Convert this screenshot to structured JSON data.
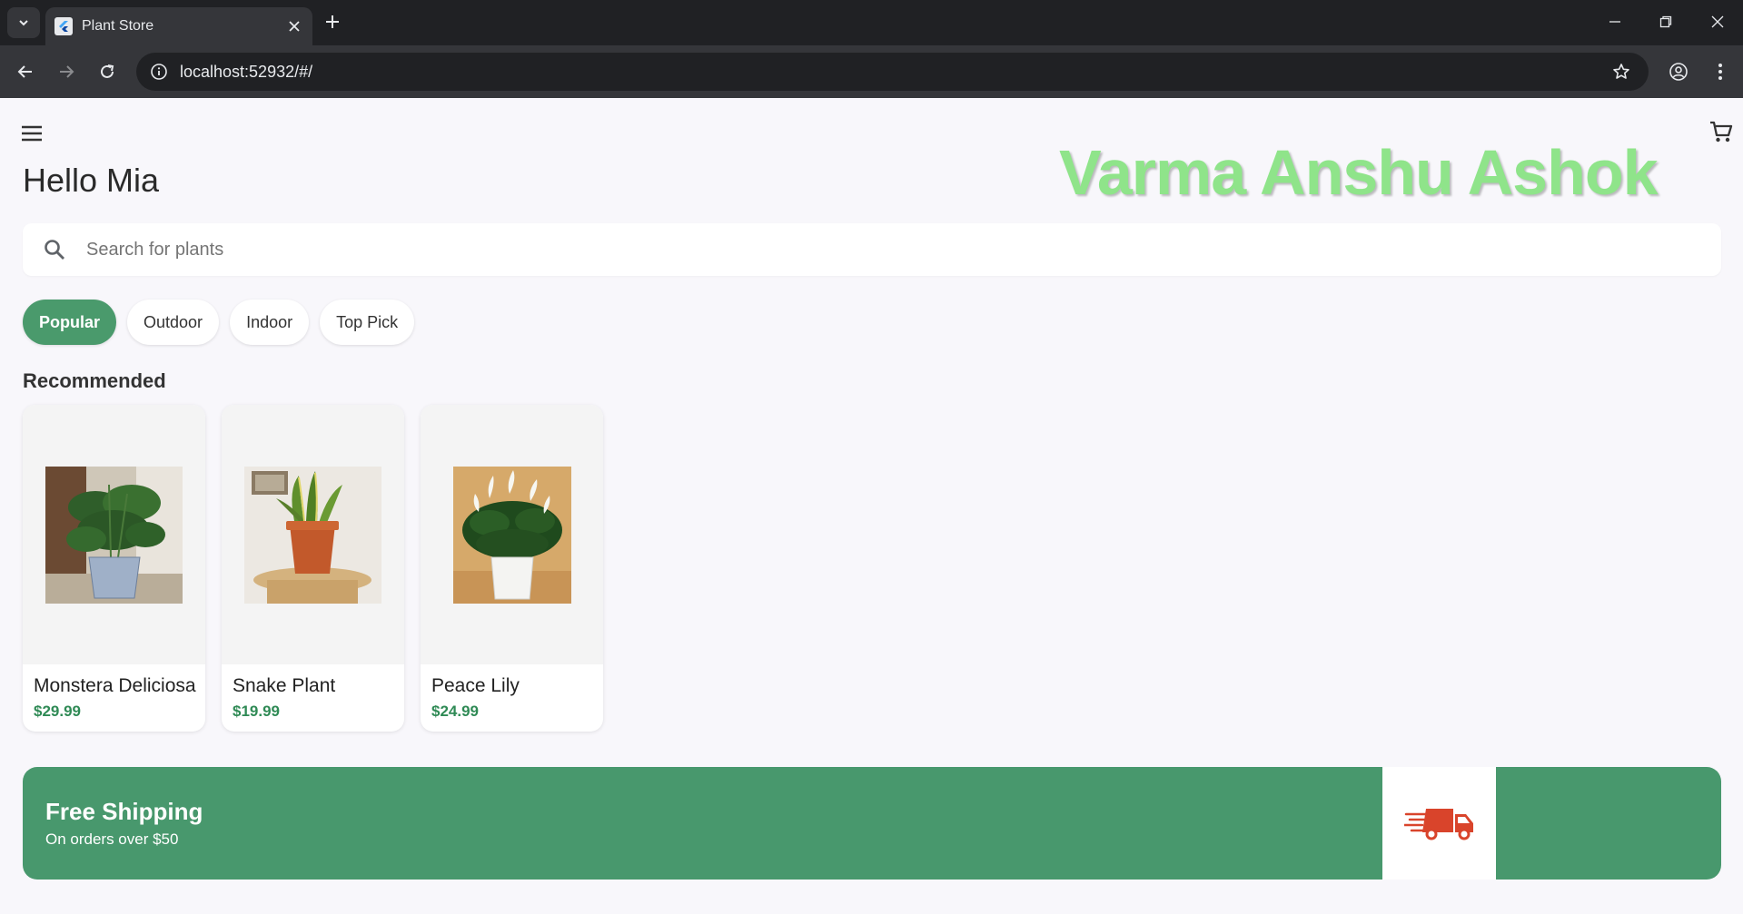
{
  "browser": {
    "tab_title": "Plant Store",
    "url": "localhost:52932/#/"
  },
  "app": {
    "greeting": "Hello Mia",
    "watermark": "Varma Anshu Ashok",
    "search": {
      "placeholder": "Search for plants",
      "value": ""
    },
    "categories": [
      "Popular",
      "Outdoor",
      "Indoor",
      "Top Pick"
    ],
    "selected_category": "Popular",
    "section_title": "Recommended",
    "products": [
      {
        "name": "Monstera Deliciosa",
        "price": "$29.99"
      },
      {
        "name": "Snake Plant",
        "price": "$19.99"
      },
      {
        "name": "Peace Lily",
        "price": "$24.99"
      }
    ],
    "banner": {
      "title": "Free Shipping",
      "subtitle": "On orders over $50"
    }
  },
  "colors": {
    "accent": "#4a9a6c",
    "price": "#2f8a55",
    "banner": "#48986d",
    "watermark": "#8fe48a",
    "truck": "#d9442b"
  }
}
